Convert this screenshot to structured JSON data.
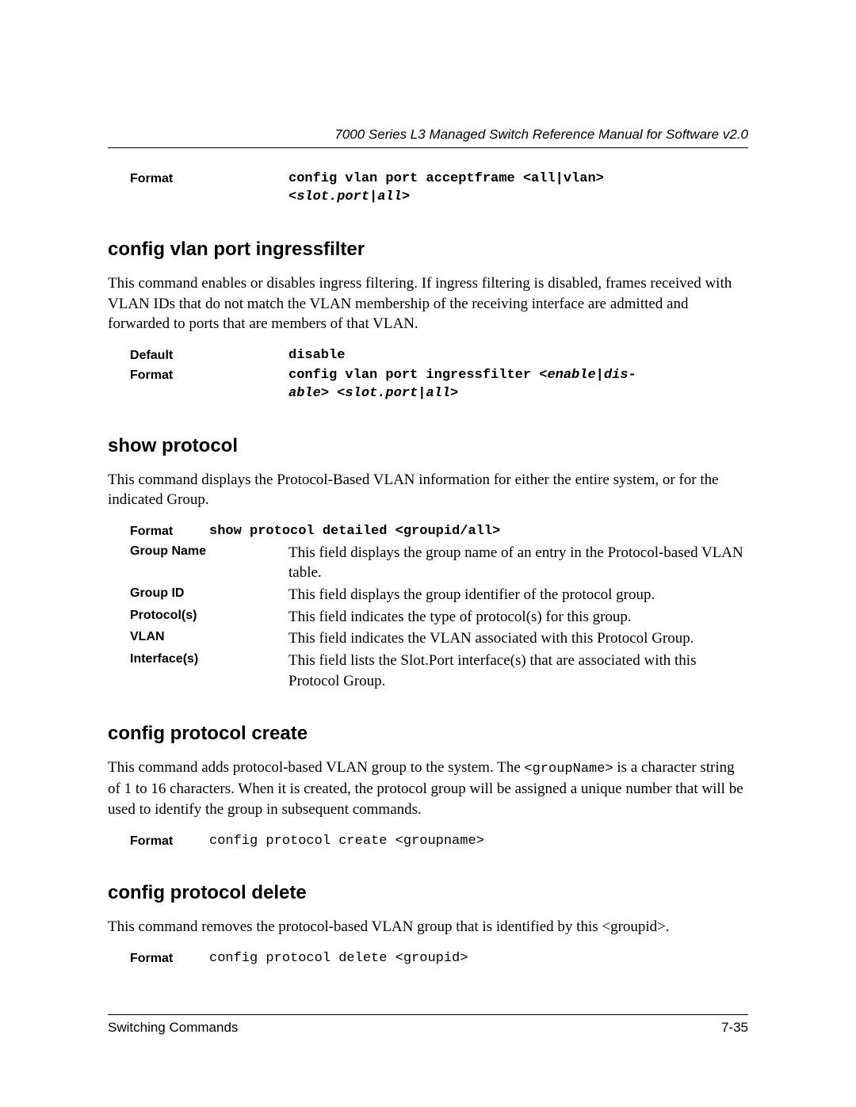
{
  "header": {
    "running_head": "7000 Series L3 Managed Switch Reference Manual for Software v2.0"
  },
  "intro_block": {
    "format_label": "Format",
    "format_line1": "config vlan port acceptframe <all|vlan>",
    "format_line2": "<slot.port|all>"
  },
  "section1": {
    "title": "config vlan port ingressfilter",
    "body": "This command enables or disables ingress filtering. If ingress filtering is disabled, frames received with VLAN IDs that do not match the VLAN membership of the receiving interface are admitted and forwarded to ports that are members of that VLAN.",
    "default_label": "Default",
    "default_value": "disable",
    "format_label": "Format",
    "format_line1a": "config vlan port ingressfilter <",
    "format_line1b": "enable|dis-",
    "format_line2a": "able",
    "format_line2b": "> <",
    "format_line2c": "slot.port|all",
    "format_line2d": ">"
  },
  "section2": {
    "title": "show protocol",
    "body": "This command displays the Protocol-Based VLAN information for either the entire system, or for the indicated Group.",
    "format_label": "Format",
    "format_value": "show protocol detailed <groupid/all>",
    "fields": [
      {
        "label": "Group Name",
        "desc": "This field displays the group name of an entry in the Protocol-based VLAN table."
      },
      {
        "label": "Group ID",
        "desc": "This field displays the group identifier of the protocol group."
      },
      {
        "label": "Protocol(s)",
        "desc": "This field indicates the type of protocol(s) for this group."
      },
      {
        "label": "VLAN",
        "desc": "This field indicates the VLAN associated with this Protocol Group."
      },
      {
        "label": "Interface(s)",
        "desc": "This field lists the Slot.Port interface(s) that are associated with this Protocol Group."
      }
    ]
  },
  "section3": {
    "title": "config protocol create",
    "body_pre": "This command adds protocol-based VLAN group to the system. The ",
    "body_code": "<groupName>",
    "body_post": " is a character string of 1 to 16 characters.  When it is created, the protocol group will be assigned a unique number that will be used to identify the group in subsequent commands.",
    "format_label": "Format",
    "format_value": "config protocol create <groupname>"
  },
  "section4": {
    "title": "config protocol delete",
    "body": "This command removes the protocol-based VLAN group that is identified by this <groupid>.",
    "format_label": "Format",
    "format_value": "config protocol delete <groupid>"
  },
  "footer": {
    "left": "Switching Commands",
    "right": "7-35"
  }
}
